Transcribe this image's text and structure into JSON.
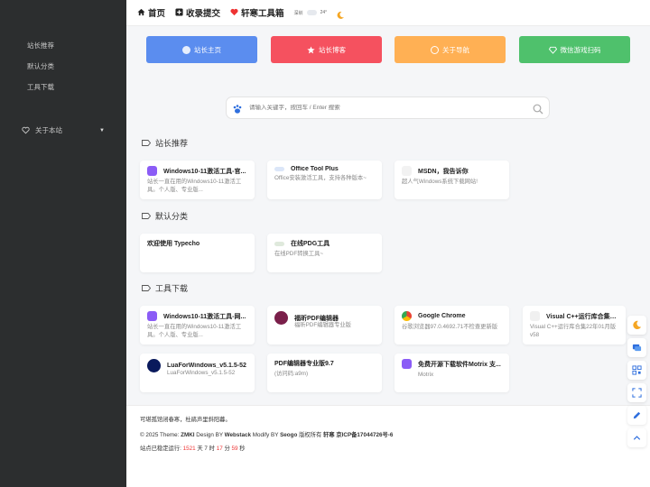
{
  "sidebar": {
    "items": [
      {
        "label": "站长推荐"
      },
      {
        "label": "默认分类"
      },
      {
        "label": "工具下载"
      }
    ],
    "about": {
      "label": "关于本站"
    }
  },
  "topnav": {
    "items": [
      {
        "label": "首页",
        "icon": "home-icon"
      },
      {
        "label": "收录提交",
        "icon": "plus-square-icon"
      },
      {
        "label": "轩寒工具箱",
        "icon": "heart-icon"
      }
    ],
    "weather": {
      "city": "深圳",
      "temp": "24°"
    }
  },
  "quick": [
    {
      "label": "站长主页",
      "color": "#5b8def"
    },
    {
      "label": "站长博客",
      "color": "#f5515f"
    },
    {
      "label": "关于导航",
      "color": "#ffb054"
    },
    {
      "label": "微信游戏扫码",
      "color": "#4fc16c"
    }
  ],
  "search": {
    "placeholder": "请输入关键字，按回车 / Enter 搜索"
  },
  "sections": [
    {
      "title": "站长推荐",
      "cards": [
        {
          "title": "Windows10-11激活工具-官...",
          "desc": "站长一直在用的Windows10-11激活工具。个人版、专业版..."
        },
        {
          "title": "Office Tool Plus",
          "desc": "Office安装激活工具，支持各种版本~"
        },
        {
          "title": "MSDN，我告诉你",
          "desc": "超人气Windows系统下载网站!"
        }
      ]
    },
    {
      "title": "默认分类",
      "cards": [
        {
          "title": "欢迎使用 Typecho",
          "desc": ""
        },
        {
          "title": "在线PDG工具",
          "desc": "在线PDF转换工具~"
        }
      ]
    },
    {
      "title": "工具下载",
      "cards": [
        {
          "title": "Windows10-11激活工具-网...",
          "desc": "站长一直在用的Windows10-11激活工具。个人版、专业版..."
        },
        {
          "title": "福昕PDF编辑器",
          "desc": "福昕PDF编辑器专业版"
        },
        {
          "title": "Google Chrome",
          "desc": "谷歌浏览器97.0.4692.71不检查更新版"
        },
        {
          "title": "Visual C++运行库合集22年...",
          "desc": "Visual C++运行库合集22年01月版v58"
        },
        {
          "title": "LuaForWindows_v5.1.5-52",
          "desc": "LuaForWindows_v5.1.5-52"
        },
        {
          "title": "PDF编辑器专业版9.7",
          "desc": "(访问码:a9m)"
        },
        {
          "title": "免费开源下载软件Motrix 支...",
          "desc": "Motrix"
        }
      ]
    }
  ],
  "footer": {
    "line1": "可堪孤馆闭春寒，杜鹃声里斜阳暮。",
    "c_prefix": "© 2025 Theme:",
    "c_theme": "ZMKI",
    "c_design": "Design BY",
    "c_webstack": "Webstack",
    "c_modify": "Modify BY",
    "c_seogo": "Seogo",
    "c_rights": "版权所有",
    "c_owner": "轩寒",
    "c_icp": "京ICP备17044726号-6",
    "run_prefix": "站点已稳定运行:",
    "days": "1521",
    "days_unit": "天",
    "hours": "7",
    "hours_unit": "时",
    "mins": "17",
    "mins_unit": "分",
    "secs": "59",
    "secs_unit": "秒"
  },
  "colors": {
    "sidebar": "#2c2e2f",
    "accent_red": "#e33333"
  }
}
